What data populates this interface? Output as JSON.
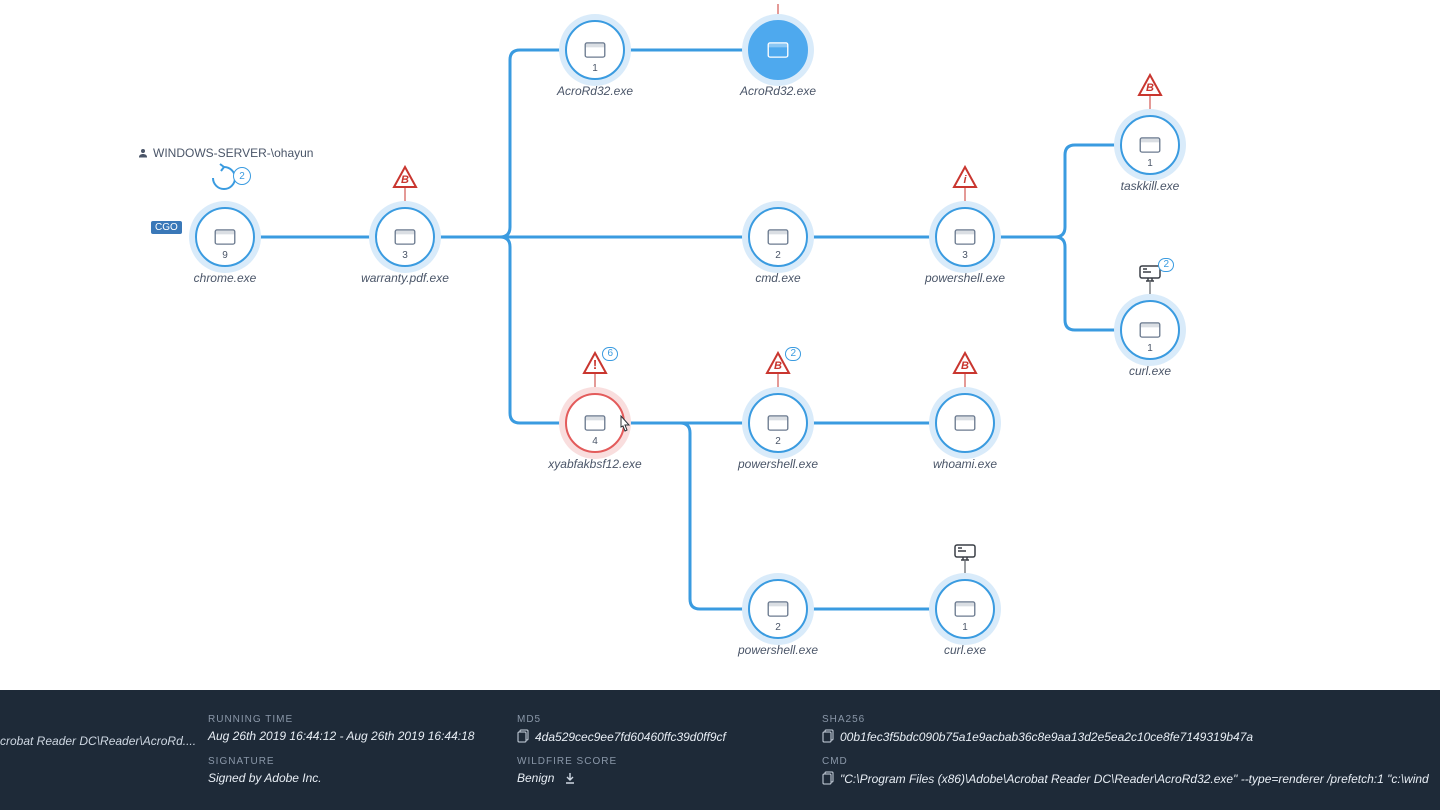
{
  "user_label": "WINDOWS-SERVER-\\ohayun",
  "nodes": {
    "chrome": {
      "label": "chrome.exe",
      "count": "9"
    },
    "warranty": {
      "label": "warranty.pdf.exe",
      "count": "3"
    },
    "acro1": {
      "label": "AcroRd32.exe",
      "count": "1"
    },
    "acro2": {
      "label": "AcroRd32.exe",
      "count": ""
    },
    "cmd": {
      "label": "cmd.exe",
      "count": "2"
    },
    "ps_top": {
      "label": "powershell.exe",
      "count": "3"
    },
    "taskkill": {
      "label": "taskkill.exe",
      "count": "1"
    },
    "curl_top": {
      "label": "curl.exe",
      "count": "1"
    },
    "xyab": {
      "label": "xyabfakbsf12.exe",
      "count": "4"
    },
    "ps_mid": {
      "label": "powershell.exe",
      "count": "2"
    },
    "whoami": {
      "label": "whoami.exe",
      "count": ""
    },
    "ps_bot": {
      "label": "powershell.exe",
      "count": "2"
    },
    "curl_bot": {
      "label": "curl.exe",
      "count": "1"
    }
  },
  "alerts": {
    "chrome_loop": "2",
    "warranty": "B",
    "xyab": {
      "glyph": "!",
      "count": "6"
    },
    "ps_mid": "B",
    "whoami": "B",
    "ps_top": "i",
    "taskkill": "B",
    "curl_top_net": "2"
  },
  "tags": {
    "chrome_cgo": "CGO"
  },
  "details": {
    "truncated_path": "crobat Reader DC\\Reader\\AcroRd....",
    "running_time": {
      "label": "RUNNING TIME",
      "value": "Aug 26th 2019 16:44:12 - Aug 26th 2019 16:44:18"
    },
    "signature": {
      "label": "SIGNATURE",
      "value": "Signed by Adobe Inc."
    },
    "md5": {
      "label": "MD5",
      "value": "4da529cec9ee7fd60460ffc39d0ff9cf"
    },
    "wildfire": {
      "label": "WILDFIRE SCORE",
      "value": "Benign"
    },
    "sha256": {
      "label": "SHA256",
      "value": "00b1fec3f5bdc090b75a1e9acbab36c8e9aa13d2e5ea2c10ce8fe7149319b47a"
    },
    "cmd": {
      "label": "CMD",
      "value": "\"C:\\Program Files (x86)\\Adobe\\Acrobat Reader DC\\Reader\\AcroRd32.exe\" --type=renderer /prefetch:1 \"c:\\wind"
    }
  }
}
